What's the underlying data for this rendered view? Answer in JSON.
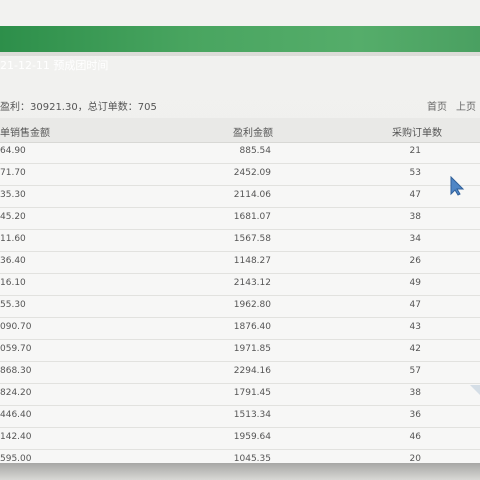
{
  "header": {
    "title": "21-12-11 预成团时间"
  },
  "summary": {
    "text": "盈利：30921.30，总订单数：705"
  },
  "pagination": {
    "first_label": "首页",
    "prev_label": "上页"
  },
  "table": {
    "headers": [
      "单销售金额",
      "盈利金额",
      "采购订单数"
    ],
    "rows": [
      [
        "64.90",
        "885.54",
        "21"
      ],
      [
        "71.70",
        "2452.09",
        "53"
      ],
      [
        "35.30",
        "2114.06",
        "47"
      ],
      [
        "45.20",
        "1681.07",
        "38"
      ],
      [
        "11.60",
        "1567.58",
        "34"
      ],
      [
        "36.40",
        "1148.27",
        "26"
      ],
      [
        "16.10",
        "2143.12",
        "49"
      ],
      [
        "55.30",
        "1962.80",
        "47"
      ],
      [
        "090.70",
        "1876.40",
        "43"
      ],
      [
        "059.70",
        "1971.85",
        "42"
      ],
      [
        "868.30",
        "2294.16",
        "57"
      ],
      [
        "824.20",
        "1791.45",
        "38"
      ],
      [
        "446.40",
        "1513.34",
        "36"
      ],
      [
        "142.40",
        "1959.64",
        "46"
      ],
      [
        "595.00",
        "1045.35",
        "20"
      ]
    ]
  },
  "icons": {
    "cursor": "mouse-pointer-icon"
  }
}
